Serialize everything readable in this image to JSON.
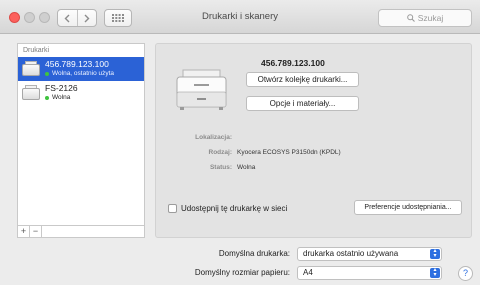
{
  "window": {
    "title": "Drukarki i skanery"
  },
  "search": {
    "placeholder": "Szukaj"
  },
  "sidebar": {
    "header": "Drukarki",
    "printers": [
      {
        "name": "456.789.123.100",
        "status": "Wolna, ostatnio użyta",
        "selected": true
      },
      {
        "name": "FS-2126",
        "status": "Wolna",
        "selected": false
      }
    ],
    "add_label": "+",
    "remove_label": "−"
  },
  "detail": {
    "printer_name": "456.789.123.100",
    "open_queue_label": "Otwórz kolejkę drukarki...",
    "options_label": "Opcje i materiały...",
    "location_label": "Lokalizacja:",
    "location_value": "",
    "kind_label": "Rodzaj:",
    "kind_value": "Kyocera ECOSYS P3150dn (KPDL)",
    "status_label": "Status:",
    "status_value": "Wolna",
    "share_label": "Udostępnij tę drukarkę w sieci",
    "share_checked": false,
    "sharing_prefs_label": "Preferencje udostępniania..."
  },
  "bottom": {
    "default_printer_label": "Domyślna drukarka:",
    "default_printer_value": "drukarka ostatnio używana",
    "paper_size_label": "Domyślny rozmiar papieru:",
    "paper_size_value": "A4",
    "help_label": "?"
  }
}
